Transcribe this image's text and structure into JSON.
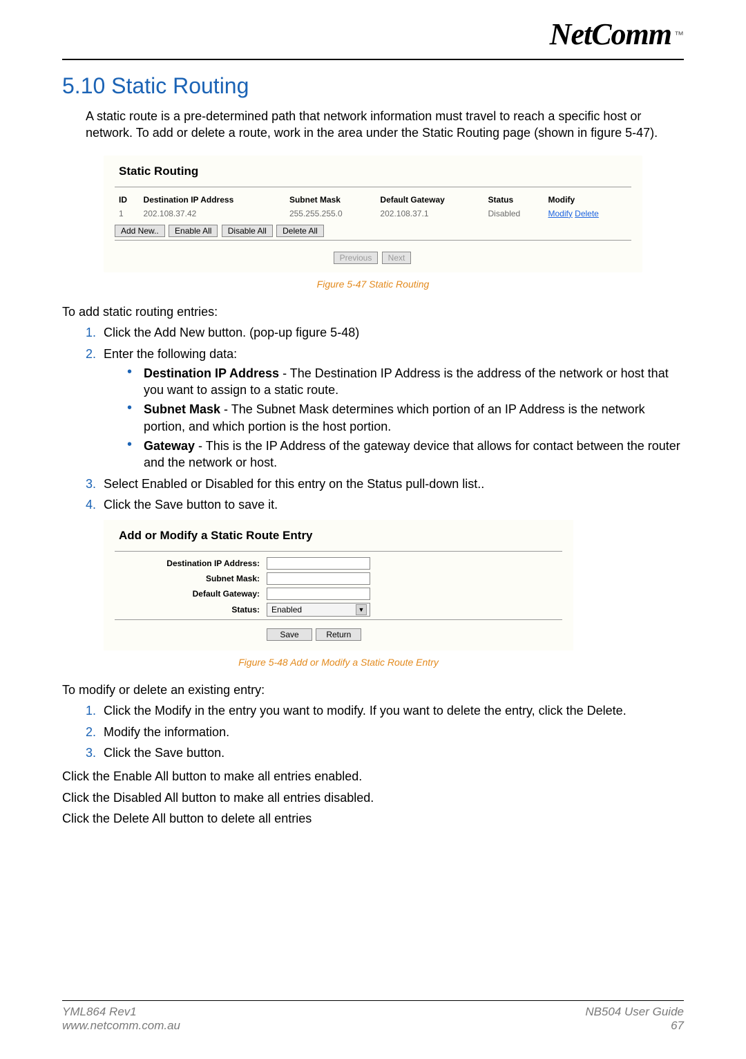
{
  "logo": {
    "brand": "NetComm",
    "tm": "™"
  },
  "section": {
    "title": "5.10 Static Routing"
  },
  "intro": "A static route is a pre-determined path that network information must travel to reach a specific host or network. To add or delete a route, work in the area under the Static Routing page (shown in figure 5-47).",
  "fig1": {
    "title": "Static Routing",
    "headers": {
      "id": "ID",
      "dest": "Destination IP Address",
      "mask": "Subnet Mask",
      "gw": "Default Gateway",
      "status": "Status",
      "modify": "Modify"
    },
    "rows": [
      {
        "id": "1",
        "dest": "202.108.37.42",
        "mask": "255.255.255.0",
        "gw": "202.108.37.1",
        "status": "Disabled",
        "modify": "Modify",
        "delete": "Delete"
      }
    ],
    "buttons": {
      "add": "Add New..",
      "enable_all": "Enable All",
      "disable_all": "Disable All",
      "delete_all": "Delete All"
    },
    "nav": {
      "prev": "Previous",
      "next": "Next"
    },
    "caption": "Figure 5-47 Static Routing"
  },
  "steps_add_intro": "To add static routing entries:",
  "steps_add": {
    "s1": "Click the Add New button. (pop-up figure 5-48)",
    "s2": "Enter the following data:",
    "b1_label": "Destination IP Address",
    "b1_text": " - The Destination IP Address is the address of the network or host that you want to assign to a static route.",
    "b2_label": "Subnet Mask",
    "b2_text": " - The Subnet Mask determines which portion of an IP Address is the network portion, and which portion is the host portion.",
    "b3_label": "Gateway",
    "b3_text": " - This is the IP Address of the gateway device that allows for contact between the router and the network or host.",
    "s3": "Select Enabled or Disabled for this entry on the Status pull-down list..",
    "s4": "Click the Save button to save it."
  },
  "fig2": {
    "title": "Add or Modify a Static Route Entry",
    "labels": {
      "dest": "Destination IP Address:",
      "mask": "Subnet Mask:",
      "gw": "Default Gateway:",
      "status": "Status:"
    },
    "status_value": "Enabled",
    "buttons": {
      "save": "Save",
      "return": "Return"
    },
    "caption": "Figure 5-48 Add or Modify a Static Route Entry"
  },
  "modify_intro": "To modify or delete an existing entry:",
  "steps_modify": {
    "s1": "Click the Modify in the entry you want to modify. If you want to delete the entry, click the Delete.",
    "s2": "Modify the information.",
    "s3": "Click the Save button."
  },
  "tail": {
    "enable": "Click the Enable All button to make all entries enabled.",
    "disable": "Click the Disabled All button to make all entries disabled.",
    "delete": "Click the Delete All button to delete all entries"
  },
  "footer": {
    "left1": "YML864 Rev1",
    "left2": "www.netcomm.com.au",
    "right1": "NB504 User Guide",
    "right2": "67"
  }
}
